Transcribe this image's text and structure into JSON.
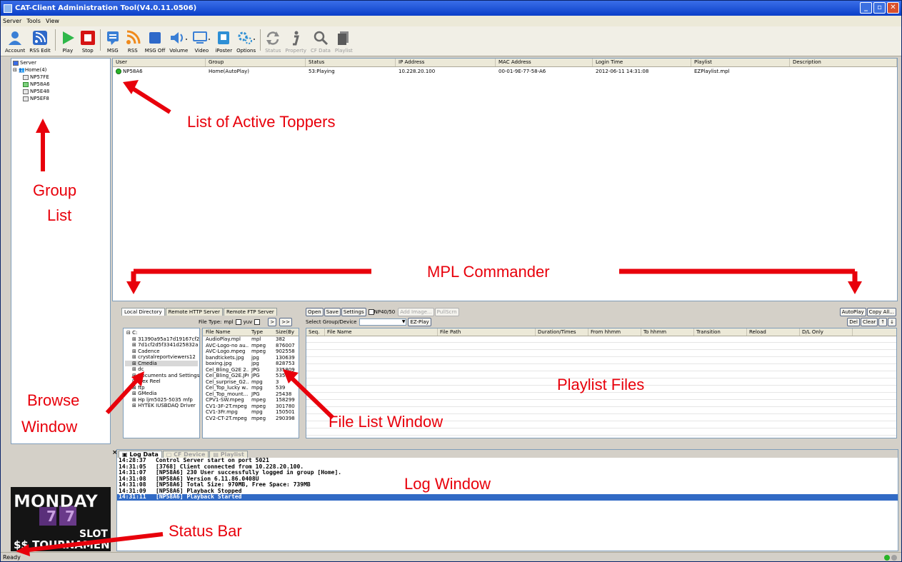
{
  "window": {
    "title": "CAT-Client Administration Tool(V4.0.11.0506)"
  },
  "menu": [
    "Server",
    "Tools",
    "View"
  ],
  "toolbar": [
    {
      "label": "Account",
      "icon": "account-icon",
      "enabled": true
    },
    {
      "label": "RSS Edit",
      "icon": "rss-edit-icon",
      "enabled": true
    },
    {
      "label": "Play",
      "icon": "play-icon",
      "enabled": true
    },
    {
      "label": "Stop",
      "icon": "stop-icon",
      "enabled": true
    },
    {
      "label": "MSG",
      "icon": "message-icon",
      "enabled": true
    },
    {
      "label": "RSS",
      "icon": "rss-icon",
      "enabled": true
    },
    {
      "label": "MSG Off",
      "icon": "message-off-icon",
      "enabled": true
    },
    {
      "label": "Volume",
      "icon": "volume-icon",
      "enabled": true
    },
    {
      "label": "Video",
      "icon": "video-icon",
      "enabled": true
    },
    {
      "label": "iPoster",
      "icon": "iposter-icon",
      "enabled": true
    },
    {
      "label": "Options",
      "icon": "options-icon",
      "enabled": true
    },
    {
      "label": "Status",
      "icon": "refresh-icon",
      "enabled": false
    },
    {
      "label": "Property",
      "icon": "info-icon",
      "enabled": false
    },
    {
      "label": "CF Data",
      "icon": "search-icon",
      "enabled": false
    },
    {
      "label": "Playlist",
      "icon": "playlist-icon",
      "enabled": false
    }
  ],
  "tree": {
    "root": "Server",
    "group": "Home(4)",
    "devices": [
      "NP57FE",
      "NP58A6",
      "NP5E48",
      "NP5EF8"
    ]
  },
  "toppers": {
    "columns": [
      "User",
      "Group",
      "Status",
      "IP Address",
      "MAC Address",
      "Login Time",
      "Playlist",
      "Description"
    ],
    "rows": [
      [
        "NP58A6",
        "Home(AutoPlay)",
        "53:Playing",
        "10.228.20.100",
        "00-01-9E-77-58-A6",
        "2012-06-11 14:31:08",
        "EZPlaylist.mpl",
        ""
      ]
    ]
  },
  "commander": {
    "tabs": [
      "Local Directory",
      "Remote HTTP Server",
      "Remote FTP Server"
    ],
    "file_type_label": "File Type:",
    "file_types": [
      "mpl",
      "yuv"
    ],
    "nav_buttons": [
      ">",
      ">>"
    ],
    "dirs": [
      "C:",
      "31390a95a17d19167cf2",
      "7d1cf2d5f3341d25832a",
      "Cadence",
      "crystalreportviewers12",
      "Cmedia",
      "dc",
      "Documents and Settings",
      "Flex Reel",
      "ftp",
      "GMedia",
      "Hp ljm5025-5035 mfp",
      "HYTEK IUSBDAQ Driver"
    ],
    "file_columns": [
      "File Name",
      "Type",
      "Size(By"
    ],
    "files": [
      [
        "AudioPlay.mpl",
        "mpl",
        "382"
      ],
      [
        "AVC-Logo-no au...",
        "mpeg",
        "876007"
      ],
      [
        "AVC-Logo.mpeg",
        "mpeg",
        "902558"
      ],
      [
        "bandtickets.jpg",
        "jpg",
        "130639"
      ],
      [
        "boxing.jpg",
        "jpg",
        "828753"
      ],
      [
        "Cel_Bling_G2E 2...",
        "JPG",
        "335809"
      ],
      [
        "Cel_Bling_G2E.JPG",
        "JPG",
        "535"
      ],
      [
        "Cel_surprise_G2...",
        "mpg",
        "3"
      ],
      [
        "Cel_Top_lucky w...",
        "mpg",
        "539"
      ],
      [
        "Cel_Top_mount...",
        "JPG",
        "25438"
      ],
      [
        "CPV1-SW.mpeg",
        "mpeg",
        "158299"
      ],
      [
        "CV1-3F-2T.mpeg",
        "mpeg",
        "301780"
      ],
      [
        "CV1-3Fr.mpg",
        "mpg",
        "150501"
      ],
      [
        "CV2-CT-2T.mpeg",
        "mpeg",
        "290398"
      ]
    ],
    "playlist_buttons": [
      "Open",
      "Save",
      "Settings"
    ],
    "np_checkbox": "NP40/50",
    "disabled_buttons": [
      "Add Image...",
      "PullScrn"
    ],
    "select_label": "Select Group/Device",
    "ez_play": "EZ-Play",
    "right_buttons": [
      "AutoPlay",
      "Copy All...",
      "Del",
      "Clear",
      "↑",
      "↓"
    ],
    "playlist_columns": [
      "Seq.",
      "File Name",
      "File Path",
      "Duration/Times",
      "From hhmm",
      "To hhmm",
      "Transition",
      "Reload",
      "D/L Only"
    ]
  },
  "log": {
    "tabs": [
      "Log Data",
      "CF Device",
      "Playlist"
    ],
    "lines": [
      [
        "14:28:37",
        "Control Server start on port 5021"
      ],
      [
        "14:31:05",
        "[3768] Client connected from 10.228.20.100."
      ],
      [
        "14:31:07",
        "[NP58A6] 230 User successfully logged in group [Home]."
      ],
      [
        "14:31:08",
        "[NP58A6] Version 6.11.86.0408U"
      ],
      [
        "14:31:08",
        "[NP58A6] Total Size: 970MB, Free Space: 739MB"
      ],
      [
        "14:31:09",
        "[NP58A6] Playback Stopped"
      ],
      [
        "14:31:11",
        "[NP58A6] Playback Started"
      ]
    ]
  },
  "banner": {
    "line1": "MONDAY",
    "line2": "SLOT",
    "line3": "$$ TOURNAMENT"
  },
  "status": "Ready",
  "annotations": {
    "toppers": "List of Active Toppers",
    "group_line1": "Group",
    "group_line2": "List",
    "mpl": "MPL Commander",
    "playlist": "Playlist Files",
    "browse_line1": "Browse",
    "browse_line2": "Window",
    "filelist": "File List Window",
    "log": "Log Window",
    "statusbar": "Status Bar"
  },
  "colors": {
    "annotation": "#e8000b",
    "title_bar": "#0a3fc8",
    "selection": "#316ac5"
  }
}
